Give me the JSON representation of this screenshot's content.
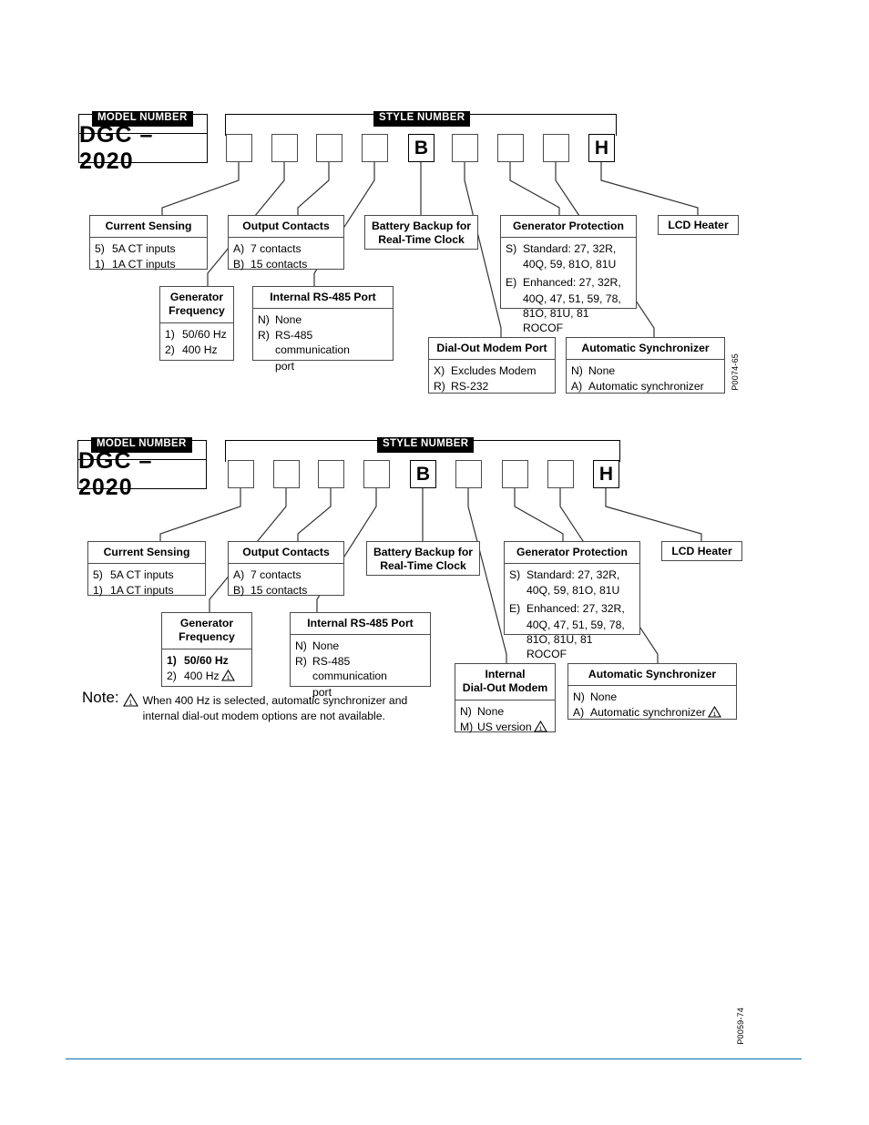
{
  "document": {
    "footer_rule_color": "#0b6ab4"
  },
  "diagrams": [
    {
      "id": "diagram-1",
      "doc_code": "P0074-65",
      "model_tag": "MODEL NUMBER",
      "style_tag": "STYLE NUMBER",
      "model_number": "DGC – 2020",
      "style_boxes": [
        "",
        "",
        "",
        "",
        "B",
        "",
        "",
        "",
        "H"
      ],
      "cards": [
        {
          "name": "current-sensing",
          "title": "Current Sensing",
          "rows": [
            {
              "key": "5)",
              "value": "5A CT inputs"
            },
            {
              "key": "1)",
              "value": "1A CT inputs"
            }
          ]
        },
        {
          "name": "generator-frequency",
          "title": "Generator\nFrequency",
          "rows": [
            {
              "key": "1)",
              "value": "50/60 Hz"
            },
            {
              "key": "2)",
              "value": "400 Hz"
            }
          ]
        },
        {
          "name": "output-contacts",
          "title": "Output Contacts",
          "rows": [
            {
              "key": "A)",
              "value": "7 contacts"
            },
            {
              "key": "B)",
              "value": "15 contacts"
            }
          ]
        },
        {
          "name": "internal-rs485-port",
          "title": "Internal RS-485 Port",
          "rows": [
            {
              "key": "N)",
              "value": "None"
            },
            {
              "key": "R)",
              "value": "RS-485 communication",
              "cont": "port"
            }
          ]
        },
        {
          "name": "battery-backup",
          "title": "Battery Backup for\nReal-Time Clock",
          "rows": []
        },
        {
          "name": "dial-out-modem-port",
          "title": "Dial-Out Modem Port",
          "rows": [
            {
              "key": "X)",
              "value": "Excludes Modem"
            },
            {
              "key": "R)",
              "value": "RS-232"
            }
          ]
        },
        {
          "name": "generator-protection",
          "title": "Generator Protection",
          "rows": [
            {
              "key": "S)",
              "value": "Standard: 27, 32R,",
              "cont": "40Q, 59, 81O, 81U"
            },
            {
              "key": "E)",
              "value": "Enhanced: 27, 32R,",
              "cont": "40Q, 47, 51, 59, 78,",
              "cont2": "81O, 81U, 81 ROCOF"
            }
          ]
        },
        {
          "name": "automatic-synchronizer",
          "title": "Automatic Synchronizer",
          "rows": [
            {
              "key": "N)",
              "value": "None"
            },
            {
              "key": "A)",
              "value": "Automatic synchronizer"
            }
          ]
        },
        {
          "name": "lcd-heater",
          "title": "LCD Heater",
          "rows": []
        }
      ]
    },
    {
      "id": "diagram-2",
      "doc_code": "P0059-74",
      "model_tag": "MODEL NUMBER",
      "style_tag": "STYLE NUMBER",
      "model_number": "DGC – 2020",
      "style_boxes": [
        "",
        "",
        "",
        "",
        "B",
        "",
        "",
        "",
        "H"
      ],
      "cards": [
        {
          "name": "current-sensing",
          "title": "Current Sensing",
          "rows": [
            {
              "key": "5)",
              "value": "5A CT inputs"
            },
            {
              "key": "1)",
              "value": "1A CT inputs"
            }
          ]
        },
        {
          "name": "generator-frequency",
          "title": "Generator\nFrequency",
          "rows": [
            {
              "key": "1)",
              "value": "50/60 Hz",
              "bold": true
            },
            {
              "key": "2)",
              "value": "400 Hz",
              "warn": "1"
            }
          ]
        },
        {
          "name": "output-contacts",
          "title": "Output Contacts",
          "rows": [
            {
              "key": "A)",
              "value": "7 contacts"
            },
            {
              "key": "B)",
              "value": "15 contacts"
            }
          ]
        },
        {
          "name": "internal-rs485-port",
          "title": "Internal RS-485 Port",
          "rows": [
            {
              "key": "N)",
              "value": "None"
            },
            {
              "key": "R)",
              "value": "RS-485 communication",
              "cont": "port"
            }
          ]
        },
        {
          "name": "battery-backup",
          "title": "Battery Backup for\nReal-Time Clock",
          "rows": []
        },
        {
          "name": "internal-dial-out-modem",
          "title": "Internal\nDial-Out Modem",
          "rows": [
            {
              "key": "N)",
              "value": "None"
            },
            {
              "key": "M)",
              "value": "US version",
              "warn": "1"
            }
          ]
        },
        {
          "name": "generator-protection",
          "title": "Generator Protection",
          "rows": [
            {
              "key": "S)",
              "value": "Standard: 27, 32R,",
              "cont": "40Q, 59, 81O, 81U"
            },
            {
              "key": "E)",
              "value": "Enhanced: 27, 32R,",
              "cont": "40Q, 47, 51, 59, 78,",
              "cont2": "81O, 81U, 81 ROCOF"
            }
          ]
        },
        {
          "name": "automatic-synchronizer",
          "title": "Automatic Synchronizer",
          "rows": [
            {
              "key": "N)",
              "value": "None"
            },
            {
              "key": "A)",
              "value": "Automatic synchronizer",
              "warn": "1"
            }
          ]
        },
        {
          "name": "lcd-heater",
          "title": "LCD Heater",
          "rows": []
        }
      ],
      "note": {
        "label": "Note:",
        "marker": "1",
        "line1": "When 400 Hz is selected, automatic synchronizer and",
        "line2": "internal dial-out modem options are not available."
      }
    }
  ]
}
